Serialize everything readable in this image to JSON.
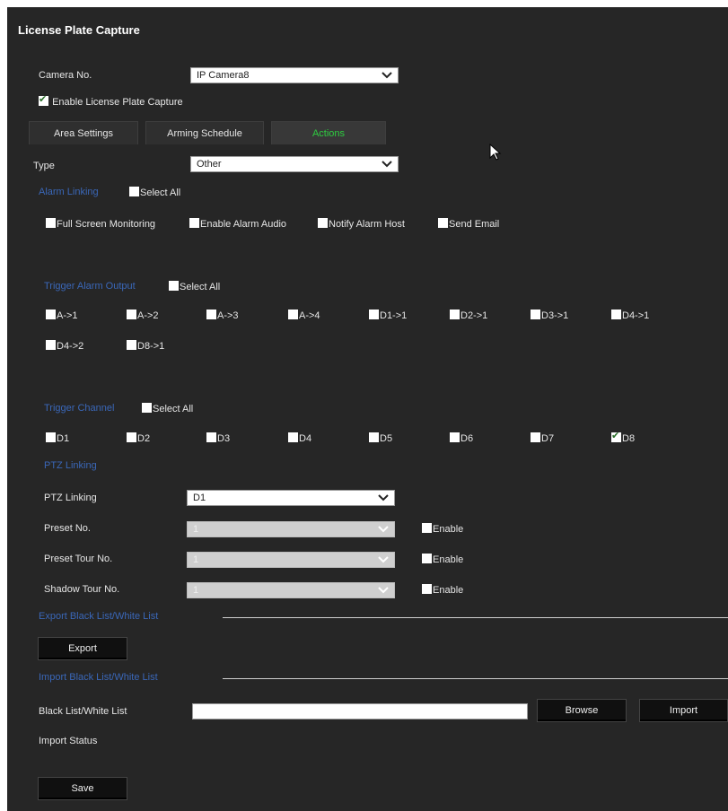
{
  "title": "License Plate Capture",
  "camera": {
    "label": "Camera No.",
    "value": "IP Camera8"
  },
  "enable": {
    "label": "Enable License Plate Capture",
    "checked": true
  },
  "tabs": [
    {
      "label": "Area Settings",
      "active": false
    },
    {
      "label": "Arming Schedule",
      "active": false
    },
    {
      "label": "Actions",
      "active": true
    }
  ],
  "type": {
    "label": "Type",
    "value": "Other"
  },
  "alarm_linking": {
    "heading": "Alarm Linking",
    "select_all": "Select All",
    "options": [
      "Full Screen Monitoring",
      "Enable Alarm Audio",
      "Notify Alarm Host",
      "Send Email"
    ]
  },
  "trigger_alarm_output": {
    "heading": "Trigger Alarm Output",
    "select_all": "Select All",
    "options": [
      "A->1",
      "A->2",
      "A->3",
      "A->4",
      "D1->1",
      "D2->1",
      "D3->1",
      "D4->1",
      "D4->2",
      "D8->1"
    ]
  },
  "trigger_channel": {
    "heading": "Trigger Channel",
    "select_all": "Select All",
    "options": [
      {
        "label": "D1",
        "checked": false
      },
      {
        "label": "D2",
        "checked": false
      },
      {
        "label": "D3",
        "checked": false
      },
      {
        "label": "D4",
        "checked": false
      },
      {
        "label": "D5",
        "checked": false
      },
      {
        "label": "D6",
        "checked": false
      },
      {
        "label": "D7",
        "checked": false
      },
      {
        "label": "D8",
        "checked": true
      }
    ]
  },
  "ptz": {
    "heading": "PTZ Linking",
    "linking_label": "PTZ Linking",
    "linking_value": "D1",
    "preset_label": "Preset No.",
    "preset_value": "1",
    "tour_label": "Preset Tour No.",
    "tour_value": "1",
    "shadow_label": "Shadow Tour No.",
    "shadow_value": "1",
    "enable_label": "Enable"
  },
  "export": {
    "heading": "Export Black List/White List",
    "button": "Export"
  },
  "import": {
    "heading": "Import Black List/White List",
    "field_label": "Black List/White List",
    "field_value": "",
    "browse": "Browse",
    "import_button": "Import",
    "status_label": "Import Status"
  },
  "save": "Save"
}
